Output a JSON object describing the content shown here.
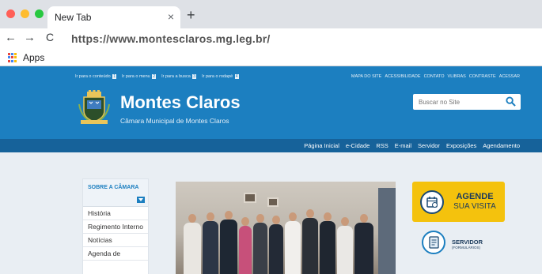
{
  "browser": {
    "tab_title": "New Tab",
    "tab_close": "×",
    "new_tab": "+",
    "back": "←",
    "forward": "→",
    "reload": "C",
    "url": "https://www.montesclaros.mg.leg.br/",
    "bookmarks": {
      "apps_label": "Apps"
    }
  },
  "site": {
    "access_links": [
      {
        "label": "Ir para o conteúdo",
        "key": "1"
      },
      {
        "label": "Ir para o menu",
        "key": "2"
      },
      {
        "label": "Ir para a busca",
        "key": "3"
      },
      {
        "label": "Ir para o rodapé",
        "key": "4"
      }
    ],
    "top_links": [
      "MAPA DO SITE",
      "ACESSIBILIDADE",
      "CONTATO",
      "VLIBRAS",
      "CONTRASTE",
      "ACESSAR"
    ],
    "title": "Montes Claros",
    "subtitle": "Câmara Municipal de Montes Claros",
    "search_placeholder": "Buscar no Site",
    "menu": [
      "Página Inicial",
      "e-Cidade",
      "RSS",
      "E-mail",
      "Servidor",
      "Exposições",
      "Agendamento"
    ],
    "sidebar": {
      "heading": "SOBRE A CÂMARA",
      "items": [
        "História",
        "Regimento Interno",
        "Notícias",
        "Agenda de"
      ]
    },
    "promo": {
      "agende_line1": "AGENDE",
      "agende_line2": "SUA VISITA",
      "servidor_line1": "SERVIDOR",
      "servidor_line2": "(FORMULÁRIOS)"
    }
  },
  "colors": {
    "header_blue": "#1c7fc0",
    "menu_blue": "#16629a",
    "agende_yellow": "#f4c20d"
  },
  "icons": [
    "close-icon",
    "plus-icon",
    "back-arrow-icon",
    "forward-arrow-icon",
    "reload-icon",
    "apps-grid-icon",
    "crest-icon",
    "search-icon",
    "chevron-down-icon",
    "calendar-icon",
    "form-icon"
  ]
}
